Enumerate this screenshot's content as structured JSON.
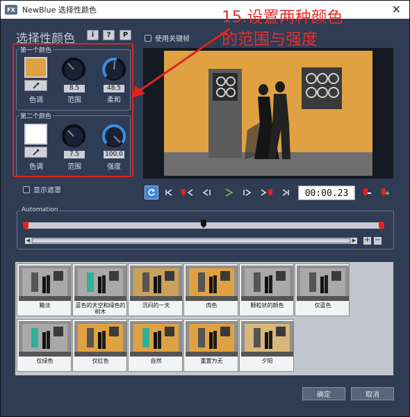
{
  "window": {
    "app_icon": "FX",
    "title": "NewBlue 选择性颜色",
    "close": "✕"
  },
  "annotation": {
    "line1": "15.设置两种颜色",
    "line2": "的范围与强度"
  },
  "effect_title": "选择性颜色",
  "header_buttons": [
    "i",
    "?",
    "P"
  ],
  "use_keyframes": {
    "label": "使用关键帧",
    "checked": false
  },
  "color1": {
    "group_label": "第一个颜色",
    "swatch_color": "#e0a142",
    "hue_label": "色调",
    "range_label": "范围",
    "range_value": "8.5",
    "soft_label": "柔和",
    "soft_value": "48.5"
  },
  "color2": {
    "group_label": "第二个颜色",
    "swatch_color": "#ffffff",
    "hue_label": "色调",
    "range_label": "范围",
    "range_value": "7.5",
    "strength_label": "强度",
    "strength_value": "100.0"
  },
  "show_mask": {
    "label": "显示遮罩",
    "checked": false
  },
  "transport": {
    "timecode": "00:00.23"
  },
  "automation": {
    "label": "Automation"
  },
  "presets": [
    {
      "label": "黯淡",
      "tone": "gray"
    },
    {
      "label": "蓝色的天空和绿色的树木",
      "tone": "teal"
    },
    {
      "label": "沉闷的一天",
      "tone": "dull"
    },
    {
      "label": "肉色",
      "tone": "warm"
    },
    {
      "label": "颗粒状的颜色",
      "tone": "gray"
    },
    {
      "label": "仅蓝色",
      "tone": "gray"
    },
    {
      "label": "仅绿色",
      "tone": "teal"
    },
    {
      "label": "仅红色",
      "tone": "warm"
    },
    {
      "label": "自然",
      "tone": "natural"
    },
    {
      "label": "重置为无",
      "tone": "warm"
    },
    {
      "label": "夕阳",
      "tone": "sunset"
    }
  ],
  "buttons": {
    "ok": "确定",
    "cancel": "取消"
  },
  "colors": {
    "annotation_red": "#e8302a",
    "wall_orange": "#e0a142",
    "panel_bg": "#303b54",
    "knob_blue": "#3c8fe8"
  }
}
